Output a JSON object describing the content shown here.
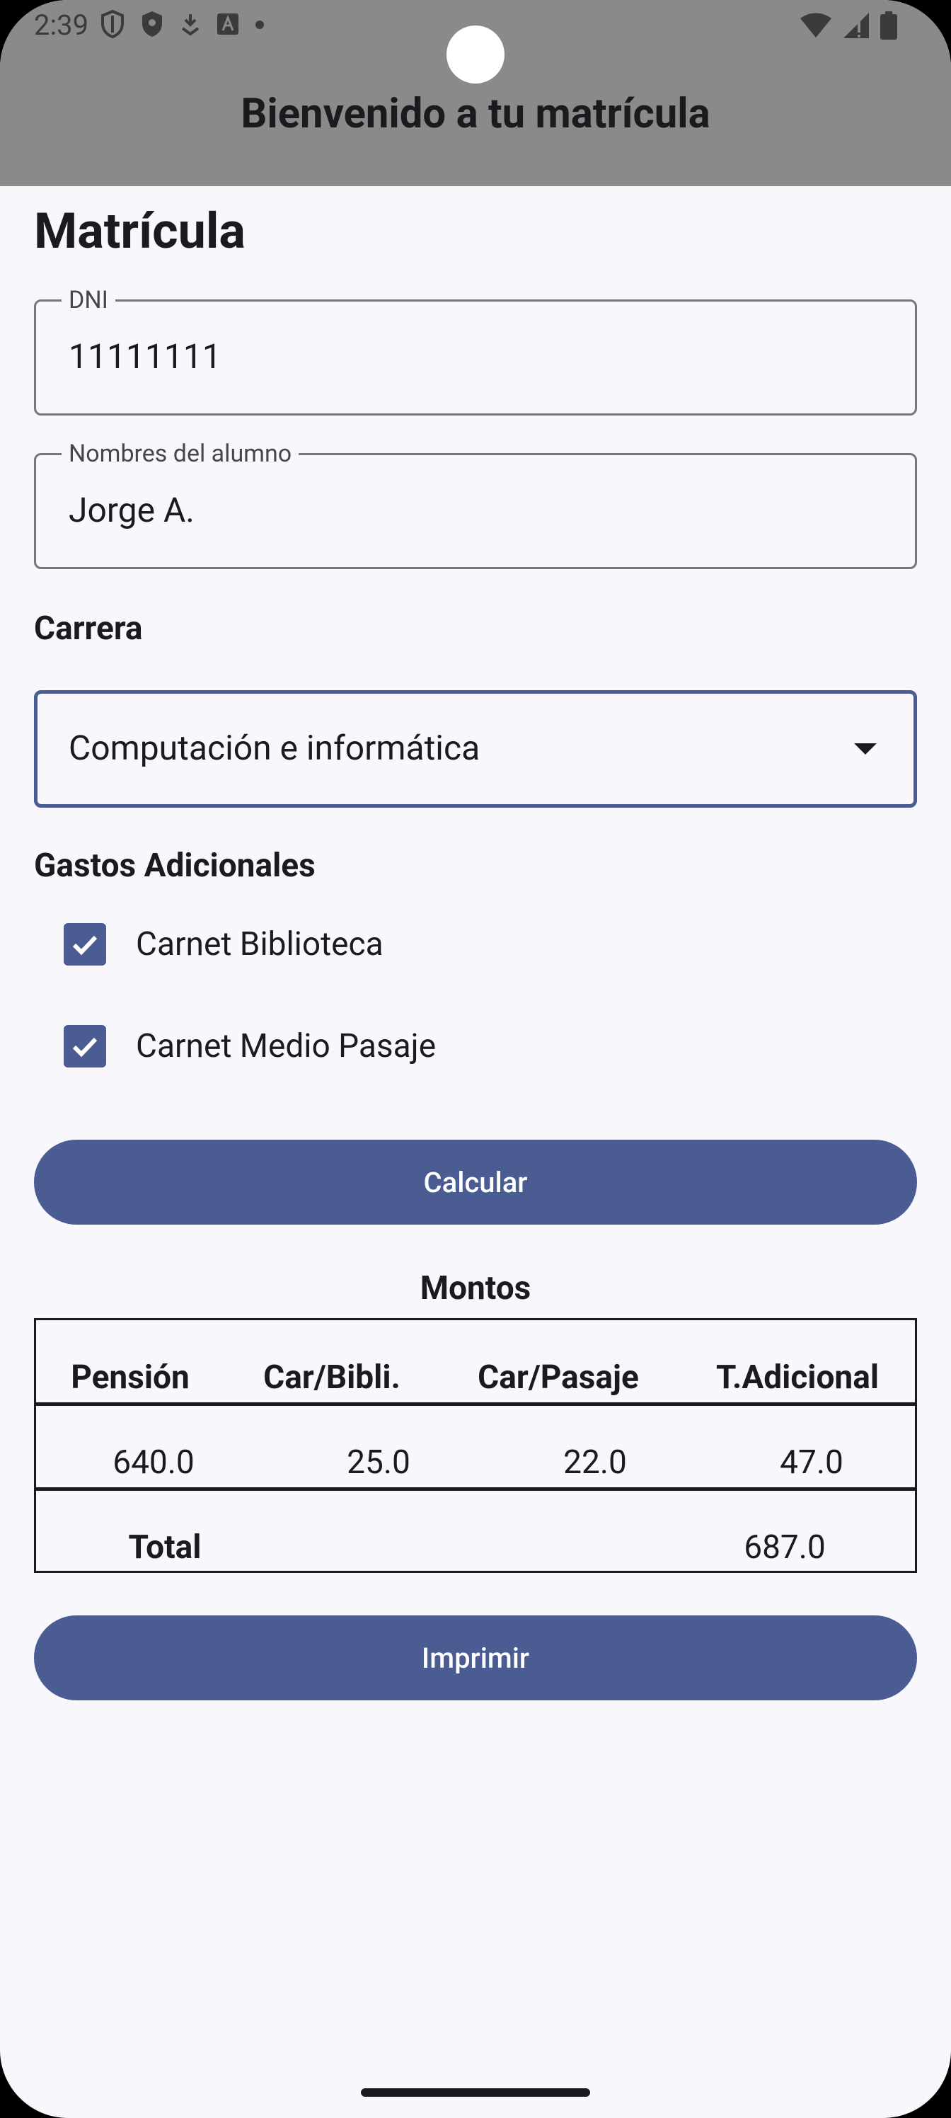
{
  "status_bar": {
    "time": "2:39",
    "left_icons": [
      "shield-outline-icon",
      "shield-filled-icon",
      "download-badge-icon",
      "font-a-icon",
      "dot-icon"
    ],
    "right_icons": [
      "wifi-icon",
      "signal-icon",
      "battery-icon"
    ]
  },
  "app_bar": {
    "title": "Bienvenido a tu matrícula"
  },
  "form": {
    "heading": "Matrícula",
    "dni": {
      "label": "DNI",
      "value": "11111111"
    },
    "student_name": {
      "label": "Nombres del alumno",
      "value": "Jorge A."
    },
    "career": {
      "label": "Carrera",
      "selected": "Computación e informática"
    },
    "extras": {
      "label": "Gastos Adicionales",
      "items": [
        {
          "label": "Carnet Biblioteca",
          "checked": true
        },
        {
          "label": "Carnet Medio Pasaje",
          "checked": true
        }
      ]
    },
    "calculate_label": "Calcular"
  },
  "amounts": {
    "title": "Montos",
    "headers": [
      "Pensión",
      "Car/Bibli.",
      "Car/Pasaje",
      "T.Adicional"
    ],
    "values": [
      "640.0",
      "25.0",
      "22.0",
      "47.0"
    ],
    "total_label": "Total",
    "total_value": "687.0"
  },
  "print_label": "Imprimir",
  "colors": {
    "primary": "#4a5c92",
    "app_bar": "#8a8a8a",
    "background": "#f7f7fc",
    "text": "#1b1b1f"
  }
}
